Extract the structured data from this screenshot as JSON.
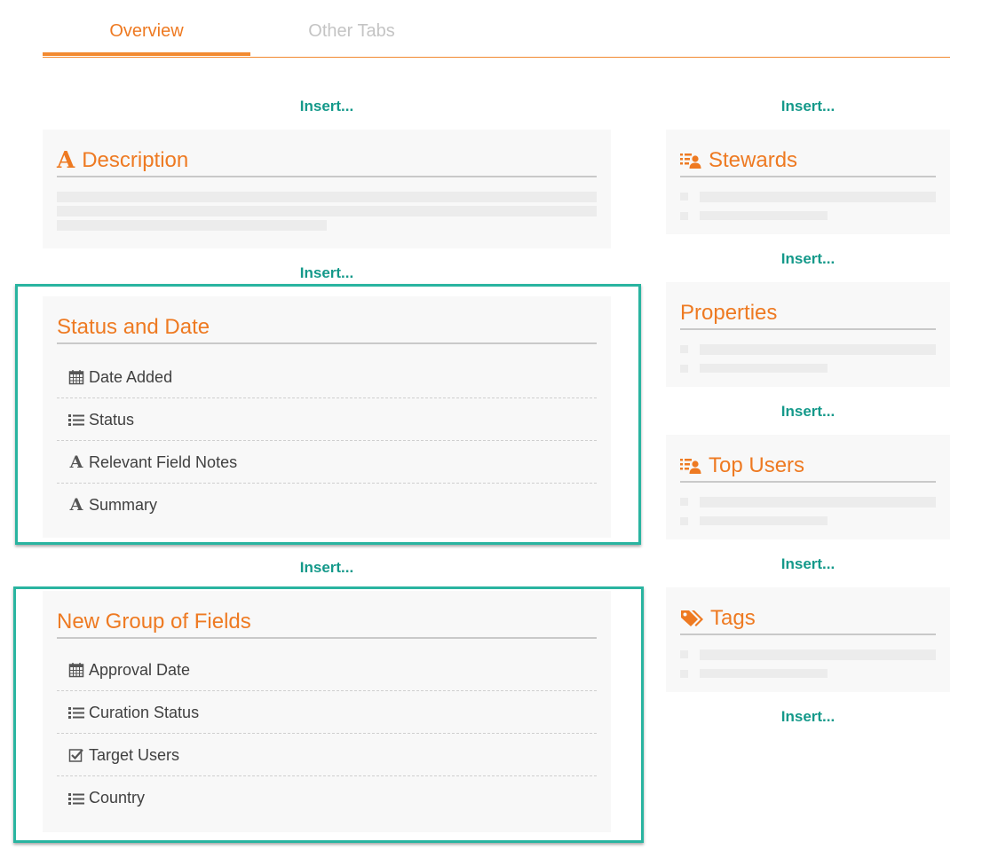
{
  "tabs": [
    {
      "label": "Overview",
      "active": true
    },
    {
      "label": "Other Tabs",
      "active": false
    }
  ],
  "insert_label": "Insert...",
  "left_column": {
    "description": {
      "title": "Description",
      "icon": "letter-a-icon"
    },
    "status_and_date": {
      "title": "Status and Date",
      "fields": [
        {
          "label": "Date Added",
          "icon": "calendar-icon"
        },
        {
          "label": "Status",
          "icon": "list-icon"
        },
        {
          "label": "Relevant Field Notes",
          "icon": "letter-a-icon"
        },
        {
          "label": "Summary",
          "icon": "letter-a-icon"
        }
      ]
    },
    "new_group": {
      "title": "New Group of Fields",
      "fields": [
        {
          "label": "Approval Date",
          "icon": "calendar-icon"
        },
        {
          "label": "Curation Status",
          "icon": "list-icon"
        },
        {
          "label": "Target Users",
          "icon": "checkbox-icon"
        },
        {
          "label": "Country",
          "icon": "list-icon"
        }
      ]
    }
  },
  "right_column": {
    "stewards": {
      "title": "Stewards",
      "icon": "users-list-icon"
    },
    "properties": {
      "title": "Properties"
    },
    "top_users": {
      "title": "Top Users",
      "icon": "users-list-icon"
    },
    "tags": {
      "title": "Tags",
      "icon": "tags-icon"
    }
  },
  "colors": {
    "accent": "#ee7a22",
    "insert": "#14998a",
    "highlight": "#29b4a0",
    "panel": "#f8f8f8"
  }
}
